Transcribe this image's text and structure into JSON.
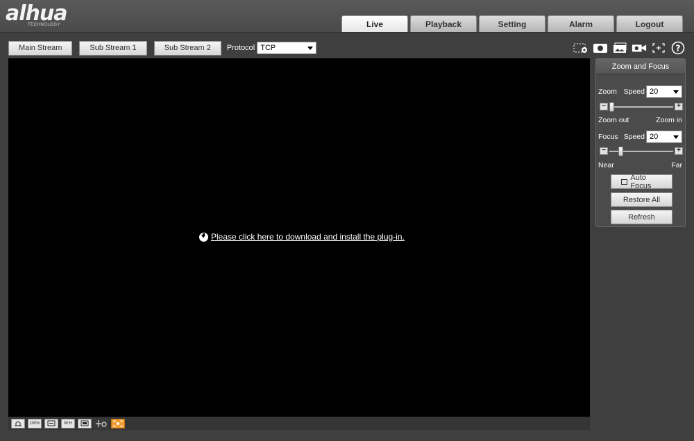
{
  "logo": {
    "brand": "alhua",
    "subtitle": "TECHNOLOGY"
  },
  "nav": {
    "tabs": [
      {
        "label": "Live",
        "active": true
      },
      {
        "label": "Playback",
        "active": false
      },
      {
        "label": "Setting",
        "active": false
      },
      {
        "label": "Alarm",
        "active": false
      },
      {
        "label": "Logout",
        "active": false
      }
    ]
  },
  "toolbar": {
    "main_stream": "Main Stream",
    "sub_stream_1": "Sub Stream 1",
    "sub_stream_2": "Sub Stream 2",
    "protocol_label": "Protocol",
    "protocol_value": "TCP"
  },
  "toolbar_icons": [
    "region-zoom-icon",
    "snapshot-icon",
    "triple-snapshot-icon",
    "record-icon",
    "easy-focus-icon",
    "help-icon"
  ],
  "video": {
    "plugin_message": "Please click here to download and install the plug-in."
  },
  "bottom_bar": {
    "buttons": [
      {
        "icon": "restore-icon",
        "label": ""
      },
      {
        "icon": "original-size-icon",
        "label": "100%"
      },
      {
        "icon": "fit-window-icon",
        "label": ""
      },
      {
        "icon": "wide-icon",
        "label": "W:H"
      },
      {
        "icon": "fullscreen-icon",
        "label": ""
      },
      {
        "icon": "ptz-icon",
        "label": ""
      },
      {
        "icon": "fisheye-icon",
        "label": ""
      }
    ]
  },
  "panel": {
    "title": "Zoom and Focus",
    "zoom": {
      "label": "Zoom",
      "speed_label": "Speed",
      "speed_value": "20",
      "min_label": "Zoom out",
      "max_label": "Zoom in",
      "position": 0.0
    },
    "focus": {
      "label": "Focus",
      "speed_label": "Speed",
      "speed_value": "20",
      "min_label": "Near",
      "max_label": "Far",
      "position": 0.15
    },
    "auto_focus": "Auto Focus",
    "restore_all": "Restore All",
    "refresh": "Refresh"
  },
  "colors": {
    "accent_orange": "#f29b30",
    "background": "#3f3f3f",
    "video_bg": "#000000"
  }
}
